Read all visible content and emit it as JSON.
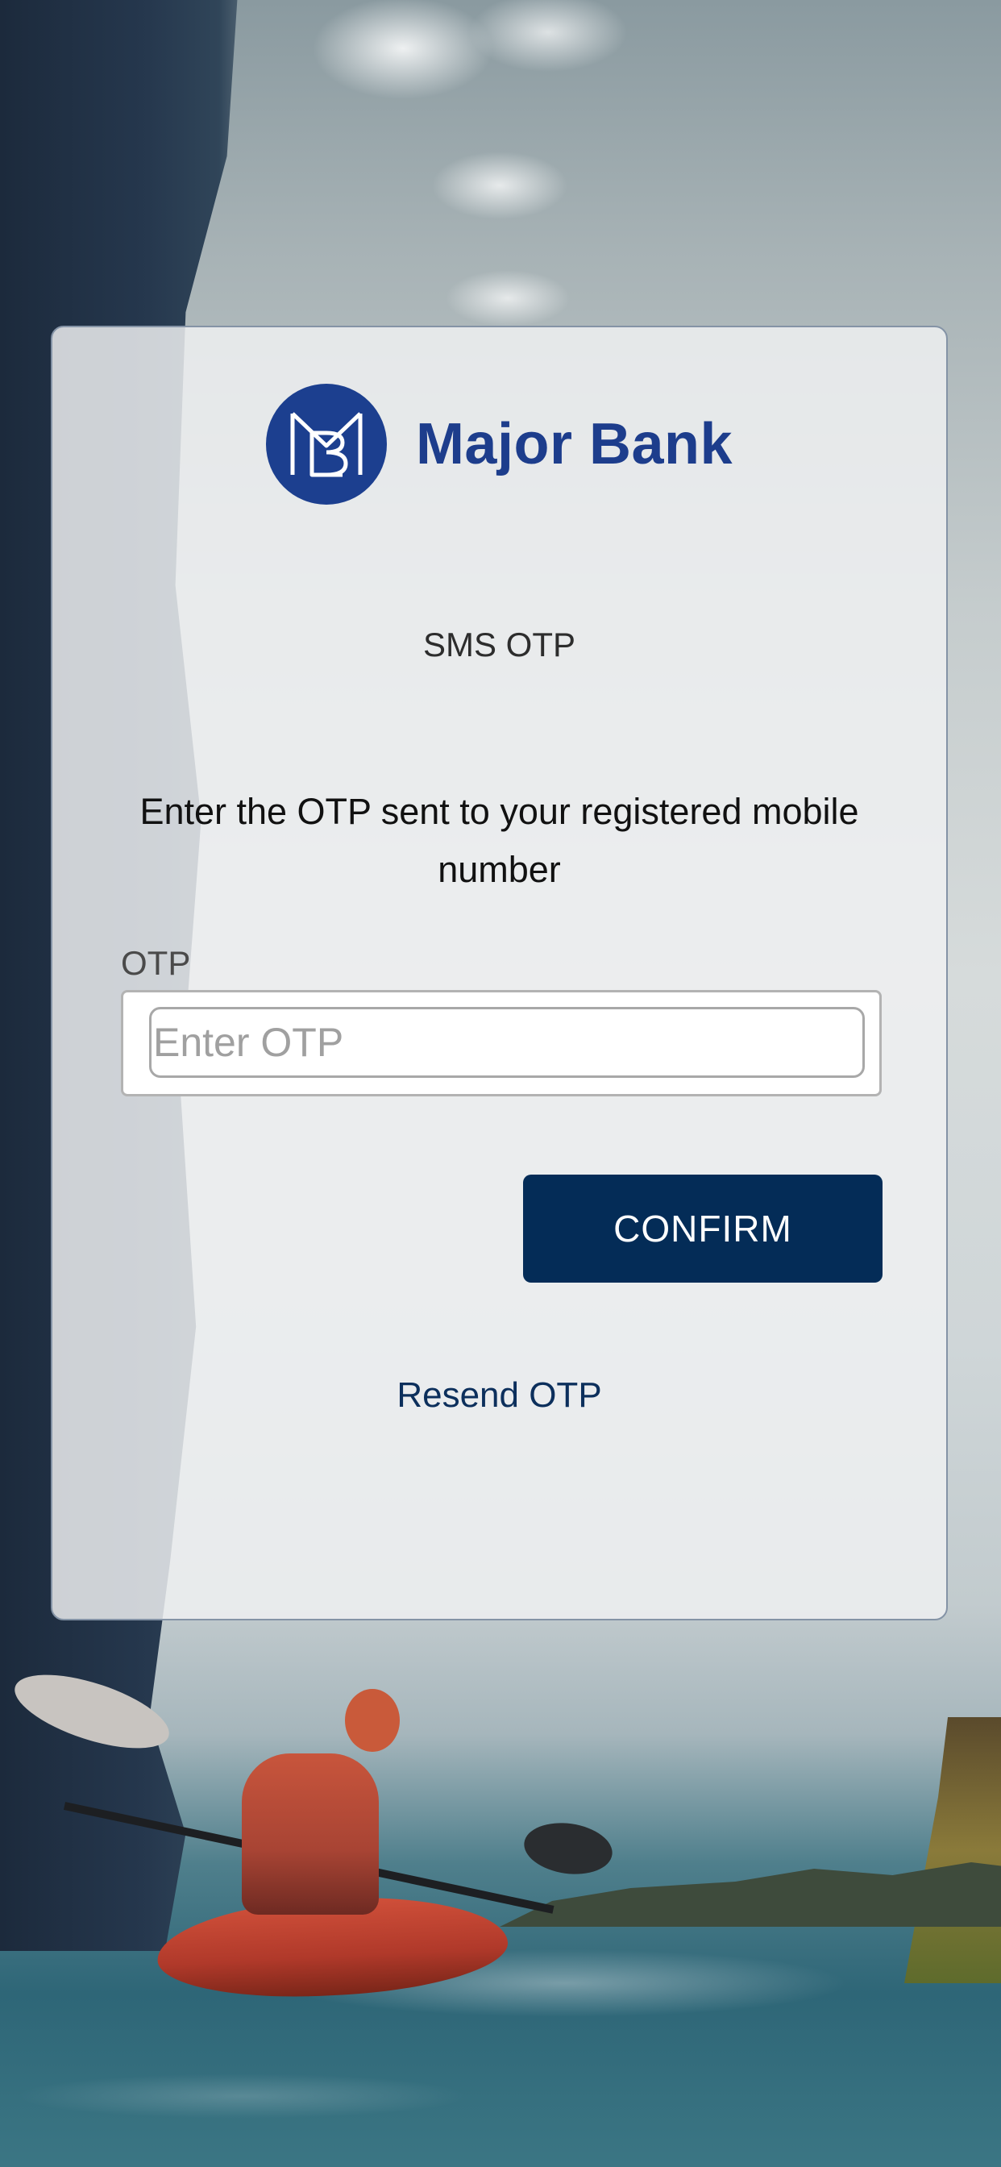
{
  "brand": {
    "name": "Major Bank",
    "logo_monogram": "MB",
    "color": "#1d3d8c"
  },
  "page": {
    "heading": "SMS OTP",
    "instruction": "Enter the OTP sent to your registered mobile number"
  },
  "otp_field": {
    "label": "OTP",
    "placeholder": "Enter OTP",
    "value": ""
  },
  "actions": {
    "confirm_label": "CONFIRM",
    "confirm_color": "#042c57",
    "resend_label": "Resend OTP"
  },
  "background": {
    "scene": "kayaker paddling near sea cliff",
    "icon": "kayaker-photo"
  }
}
